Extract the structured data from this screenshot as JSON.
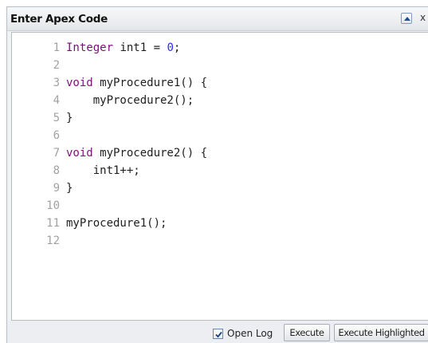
{
  "window": {
    "title": "Enter Apex Code",
    "close_glyph": "x"
  },
  "editor": {
    "lines": [
      {
        "n": "1",
        "tokens": [
          {
            "t": "Integer",
            "c": "type"
          },
          {
            "t": " int1 = ",
            "c": "plain"
          },
          {
            "t": "0",
            "c": "num"
          },
          {
            "t": ";",
            "c": "plain"
          }
        ]
      },
      {
        "n": "2",
        "tokens": []
      },
      {
        "n": "3",
        "tokens": [
          {
            "t": "void",
            "c": "kw"
          },
          {
            "t": " myProcedure1() {",
            "c": "plain"
          }
        ]
      },
      {
        "n": "4",
        "tokens": [
          {
            "t": "    myProcedure2();",
            "c": "plain"
          }
        ]
      },
      {
        "n": "5",
        "tokens": [
          {
            "t": "}",
            "c": "plain"
          }
        ]
      },
      {
        "n": "6",
        "tokens": []
      },
      {
        "n": "7",
        "tokens": [
          {
            "t": "void",
            "c": "kw"
          },
          {
            "t": " myProcedure2() {",
            "c": "plain"
          }
        ]
      },
      {
        "n": "8",
        "tokens": [
          {
            "t": "    int1++;",
            "c": "plain"
          }
        ]
      },
      {
        "n": "9",
        "tokens": [
          {
            "t": "}",
            "c": "plain"
          }
        ]
      },
      {
        "n": "10",
        "tokens": []
      },
      {
        "n": "11",
        "tokens": [
          {
            "t": "myProcedure1();",
            "c": "plain"
          }
        ]
      },
      {
        "n": "12",
        "tokens": []
      }
    ]
  },
  "footer": {
    "open_log_label": "Open Log",
    "open_log_checked": true,
    "execute_label": "Execute",
    "execute_highlighted_label": "Execute Highlighted"
  },
  "icons": {
    "collapse": "triangle-up-icon",
    "close": "close-icon",
    "checkbox": "check-icon"
  }
}
